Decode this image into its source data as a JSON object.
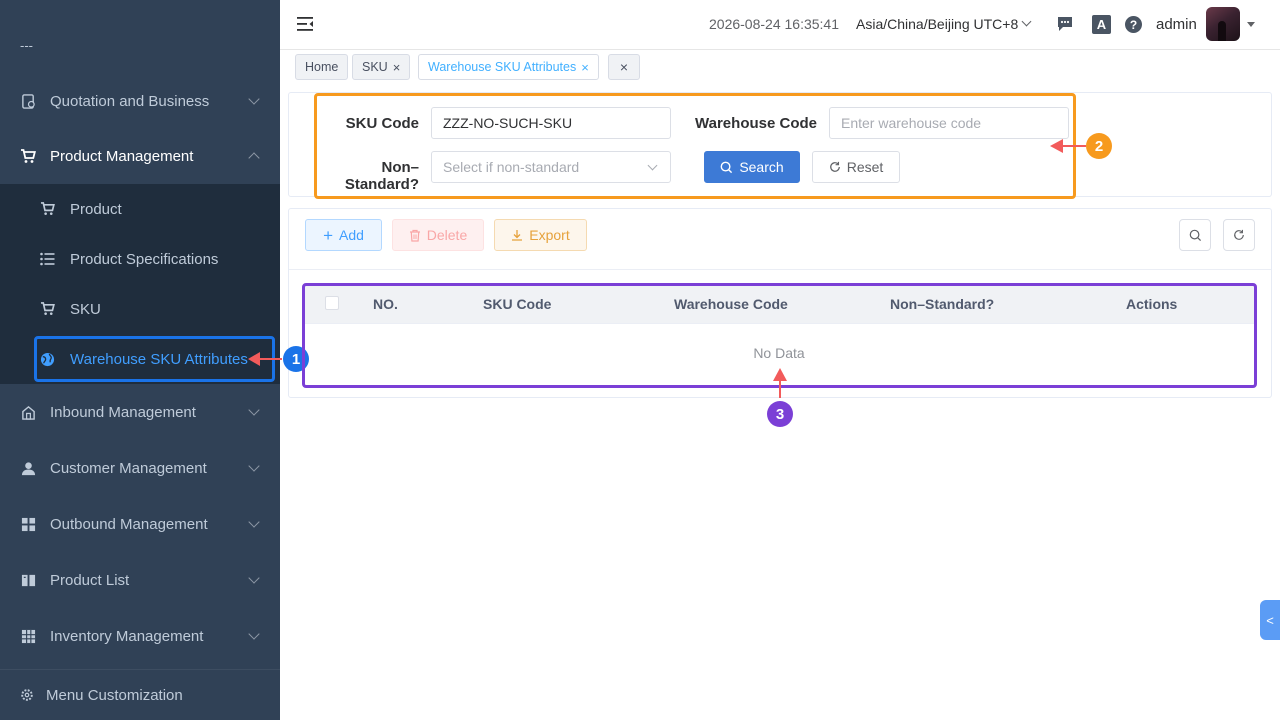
{
  "sidebar": {
    "top_partial": "---",
    "items": [
      {
        "label": "Quotation and Business"
      },
      {
        "label": "Product Management"
      },
      {
        "label": "Inbound Management"
      },
      {
        "label": "Customer Management"
      },
      {
        "label": "Outbound Management"
      },
      {
        "label": "Product List"
      },
      {
        "label": "Inventory Management"
      }
    ],
    "subitems": [
      {
        "label": "Product"
      },
      {
        "label": "Product Specifications"
      },
      {
        "label": "SKU"
      },
      {
        "label": "Warehouse SKU Attributes"
      }
    ],
    "footer": "Menu Customization"
  },
  "header": {
    "datetime": "2026-08-24 16:35:41",
    "timezone": "Asia/China/Beijing UTC+8",
    "lang_icon_text": "A",
    "help_icon_text": "?",
    "user": "admin"
  },
  "tags": [
    {
      "label": "Home"
    },
    {
      "label": "SKU"
    },
    {
      "label": "Warehouse SKU Attributes"
    }
  ],
  "search": {
    "sku_label": "SKU Code",
    "sku_value": "ZZZ-NO-SUCH-SKU",
    "warehouse_label": "Warehouse Code",
    "warehouse_placeholder": "Enter warehouse code",
    "nonstd_label": "Non–Standard?",
    "nonstd_placeholder": "Select if non-standard",
    "search_btn": "Search",
    "reset_btn": "Reset"
  },
  "toolbar": {
    "add": "Add",
    "delete": "Delete",
    "export": "Export"
  },
  "table": {
    "columns": [
      "NO.",
      "SKU Code",
      "Warehouse Code",
      "Non–Standard?",
      "Actions"
    ],
    "empty_text": "No Data"
  },
  "annotations": {
    "badge1": "1",
    "badge2": "2",
    "badge3": "3",
    "colors": {
      "blue": "#1a73e8",
      "orange": "#f79a1e",
      "purple": "#7b3fd6",
      "arrow": "#f25b5b"
    }
  },
  "side_tab": "<"
}
